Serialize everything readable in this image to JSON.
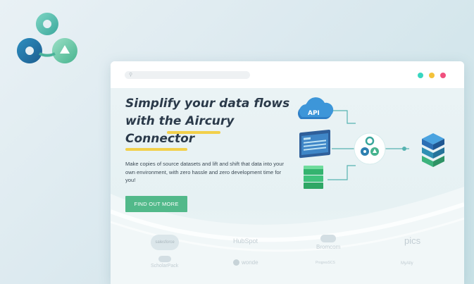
{
  "hero": {
    "headline_line1": "Simplify your data flows",
    "headline_line2": "with the Aircury",
    "headline_line3": "Connector",
    "description": "Make copies of source datasets and lift and shift that data into your own environment, with zero hassle and zero development time for you!",
    "cta_label": "FIND OUT MORE"
  },
  "diagram": {
    "api_label": "API"
  },
  "partners": {
    "salesforce": "salesforce",
    "hubspot": "HubSpot",
    "bromcom": "Bromcom",
    "pics": "pics",
    "scholarpack": "ScholarPack",
    "wonde": "wonde",
    "progresso": "ProgresSCS",
    "arbor": "MyAlly"
  },
  "colors": {
    "accent": "#52b98a",
    "underline": "#f2d04a",
    "dot_teal": "#38d6c0",
    "dot_yellow": "#f4c23a",
    "dot_pink": "#f0507e"
  }
}
